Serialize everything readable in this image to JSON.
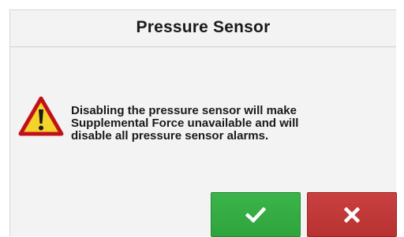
{
  "dialog": {
    "title": "Pressure Sensor",
    "message_lines": [
      "Disabling the pressure sensor will make",
      "Supplemental Force unavailable and will",
      "disable all pressure sensor alarms."
    ],
    "icon": "warning-triangle-icon"
  },
  "buttons": {
    "confirm": {
      "icon": "checkmark-icon",
      "color": "#35ad44"
    },
    "cancel": {
      "icon": "x-icon",
      "color": "#bf3838"
    }
  }
}
